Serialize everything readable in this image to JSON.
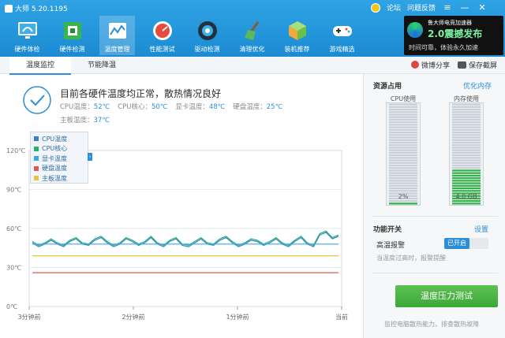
{
  "app": {
    "title": "大师 5.20.1195",
    "links": [
      "论坛",
      "问题反馈"
    ]
  },
  "nav": [
    {
      "label": "硬件体检",
      "icon": "monitor-icon"
    },
    {
      "label": "硬件检测",
      "icon": "circuit-board-icon"
    },
    {
      "label": "温度管理",
      "icon": "temperature-chart-icon"
    },
    {
      "label": "性能测试",
      "icon": "speedometer-icon"
    },
    {
      "label": "驱动检测",
      "icon": "gear-chip-icon"
    },
    {
      "label": "清理优化",
      "icon": "broom-icon"
    },
    {
      "label": "装机推荐",
      "icon": "cube-icon"
    },
    {
      "label": "游戏精选",
      "icon": "gamepad-icon"
    }
  ],
  "active_nav_index": 2,
  "promo": {
    "line1": "鲁大师电竞加速器",
    "line2": "2.0震撼发布",
    "line3": "时间可靠，体验永久加速"
  },
  "tabs": [
    "温度监控",
    "节能降温"
  ],
  "tab_actions": [
    "微博分享",
    "保存截屏"
  ],
  "status": {
    "message": "目前各硬件温度均正常，散热情况良好",
    "temps": [
      {
        "label": "CPU温度：",
        "value": "52℃"
      },
      {
        "label": "CPU核心：",
        "value": "50℃"
      },
      {
        "label": "显卡温度：",
        "value": "48℃"
      },
      {
        "label": "硬盘温度：",
        "value": "25℃"
      },
      {
        "label": "主板温度：",
        "value": "37℃"
      }
    ]
  },
  "chart_data": {
    "type": "line",
    "x_ticks": [
      "3分钟前",
      "2分钟前",
      "1分钟前",
      "当前"
    ],
    "y_ticks": [
      "0℃",
      "30℃",
      "60℃",
      "90℃",
      "120℃"
    ],
    "ylim": [
      0,
      120
    ],
    "series": [
      {
        "name": "CPU温度",
        "color": "#3b7dd8",
        "values": [
          49,
          46,
          48,
          51,
          48,
          46,
          50,
          52,
          48,
          47,
          51,
          53,
          49,
          46,
          48,
          52,
          50,
          47,
          49,
          53,
          48,
          46,
          50,
          52,
          47,
          46,
          49,
          52,
          48,
          47,
          51,
          53,
          49,
          46,
          48,
          51,
          50,
          47,
          49,
          52,
          48,
          46,
          50,
          53,
          48,
          46,
          55,
          57,
          52,
          54
        ]
      },
      {
        "name": "CPU核心",
        "color": "#21b36b",
        "values": [
          50,
          47,
          49,
          52,
          49,
          47,
          51,
          53,
          49,
          48,
          52,
          54,
          50,
          47,
          49,
          53,
          51,
          48,
          50,
          54,
          49,
          47,
          51,
          53,
          48,
          47,
          50,
          53,
          49,
          48,
          52,
          54,
          50,
          47,
          49,
          52,
          51,
          48,
          50,
          53,
          49,
          47,
          51,
          54,
          49,
          47,
          56,
          58,
          53,
          55
        ]
      },
      {
        "name": "显卡温度",
        "color": "#3aa8e8",
        "values": [
          48,
          48,
          48,
          48,
          48,
          48,
          48,
          48,
          48,
          48
        ]
      },
      {
        "name": "硬盘温度",
        "color": "#e05a4f",
        "values": [
          26,
          26,
          26,
          26,
          26,
          26,
          26,
          26,
          26,
          26
        ]
      },
      {
        "name": "主板温度",
        "color": "#e8c53b",
        "values": [
          39,
          39,
          39,
          39,
          39,
          39,
          39,
          39,
          39,
          39
        ]
      }
    ],
    "grid": true,
    "legend_position": "top-left"
  },
  "side": {
    "resource_title": "资源占用",
    "optimize_link": "优化内存",
    "cpu_label": "CPU使用",
    "cpu_value": "2%",
    "cpu_fraction": 0.02,
    "mem_label": "内存使用",
    "mem_value": "4.0 GB",
    "mem_fraction": 0.34,
    "switch_title": "功能开关",
    "settings_link": "设置",
    "alarm_label": "高温报警",
    "alarm_state": "已开启",
    "alarm_note": "当温度过高时，报警提醒",
    "stress_button": "温度压力测试",
    "stress_note": "监控电脑散热能力，排查散热故障"
  }
}
